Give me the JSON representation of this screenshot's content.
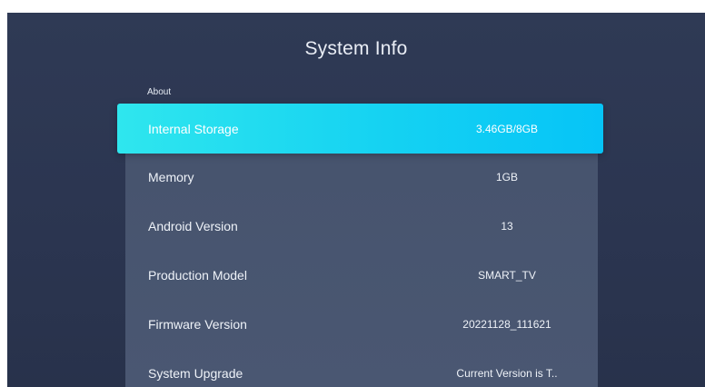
{
  "title": "System Info",
  "section": "About",
  "items": [
    {
      "label": "Internal Storage",
      "value": "3.46GB/8GB",
      "focused": true
    },
    {
      "label": "Memory",
      "value": "1GB",
      "focused": false
    },
    {
      "label": "Android Version",
      "value": "13",
      "focused": false
    },
    {
      "label": "Production Model",
      "value": "SMART_TV",
      "focused": false
    },
    {
      "label": "Firmware Version",
      "value": "20221128_111621",
      "focused": false
    },
    {
      "label": "System Upgrade",
      "value": "Current Version is T..",
      "focused": false
    }
  ],
  "colors": {
    "background": "#2f3a55",
    "panel": "#46536d",
    "focus_start": "#2fe6ee",
    "focus_end": "#06c4f7"
  }
}
